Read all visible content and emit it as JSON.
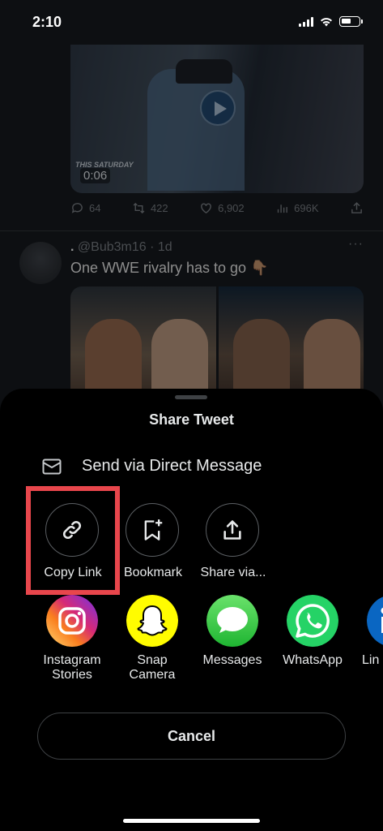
{
  "status_bar": {
    "time": "2:10"
  },
  "timeline": {
    "tweet1": {
      "video_duration": "0:06",
      "video_caption": "THIS SATURDAY",
      "replies": "64",
      "retweets": "422",
      "likes": "6,902",
      "views": "696K"
    },
    "tweet2": {
      "display_name": ".",
      "handle_time": "@Bub3m16 · 1d",
      "text": "One WWE rivalry has to go 👇🏽",
      "more": "···"
    }
  },
  "share_sheet": {
    "title": "Share Tweet",
    "dm_label": "Send via Direct Message",
    "actions": [
      {
        "label": "Copy Link",
        "icon": "link-icon"
      },
      {
        "label": "Bookmark",
        "icon": "bookmark-add-icon"
      },
      {
        "label": "Share via...",
        "icon": "share-upload-icon"
      }
    ],
    "apps": [
      {
        "label": "Instagram\nStories",
        "icon": "instagram-icon"
      },
      {
        "label": "Snap\nCamera",
        "icon": "snapchat-icon"
      },
      {
        "label": "Messages",
        "icon": "messages-icon"
      },
      {
        "label": "WhatsApp",
        "icon": "whatsapp-icon"
      },
      {
        "label": "Lin",
        "icon": "linkedin-icon"
      }
    ],
    "cancel_label": "Cancel"
  },
  "colors": {
    "highlight": "#e8464c",
    "sheet_background": "#000000",
    "messages_green": "#34c759",
    "whatsapp_green": "#25d366",
    "snapchat_yellow": "#fffc00",
    "linkedin_blue": "#0a66c2"
  }
}
